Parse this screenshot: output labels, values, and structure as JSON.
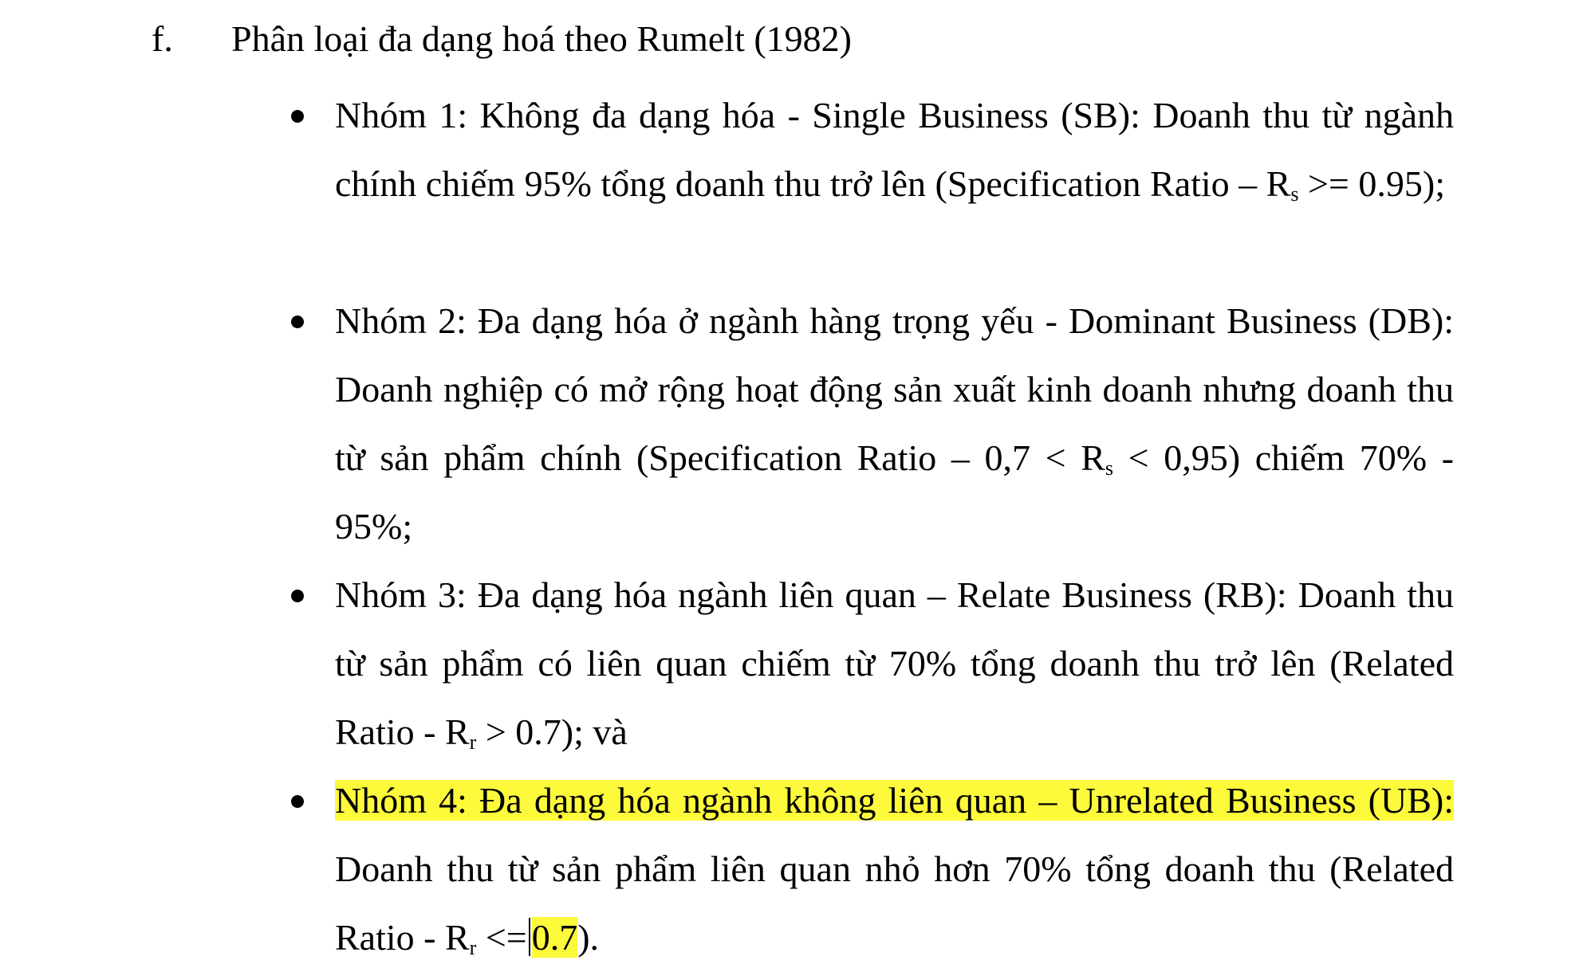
{
  "heading": {
    "marker": "f.",
    "text": "Phân loại đa dạng hoá theo Rumelt (1982)"
  },
  "items": [
    {
      "text_main": "Nhóm 1: Không đa dạng hóa - Single Business (SB): Doanh thu từ ngành chính chiếm 95% tổng doanh thu trở lên (Specification Ratio – R",
      "sub": "s",
      "text_end": " >= 0.95);"
    },
    {
      "text_main": "Nhóm 2: Đa dạng hóa ở ngành hàng trọng yếu - Dominant Business (DB): Doanh nghiệp có mở rộng hoạt động sản xuất kinh doanh nhưng doanh thu từ sản phẩm chính (Specification Ratio – 0,7 < R",
      "sub": "s",
      "text_end": " < 0,95) chiếm 70% - 95%;"
    },
    {
      "text_main": "Nhóm 3: Đa dạng hóa ngành liên quan – Relate Business (RB): Doanh thu từ sản phẩm có liên quan chiếm từ 70% tổng doanh thu trở lên (Related Ratio - R",
      "sub": "r",
      "text_end": " > 0.7); và"
    },
    {
      "highlight": "Nhóm 4: Đa dạng hóa ngành không liên quan – Unrelated Business (UB):",
      "text_main": " Doanh thu từ sản phẩm liên quan nhỏ hơn 70% tổng doanh thu (Related Ratio - R",
      "sub": "r",
      "text_op": " <=",
      "highlight_value": "0.7",
      "text_end": ")."
    }
  ],
  "colors": {
    "highlight": "#fdf93b",
    "text": "#000000",
    "background": "#ffffff"
  }
}
